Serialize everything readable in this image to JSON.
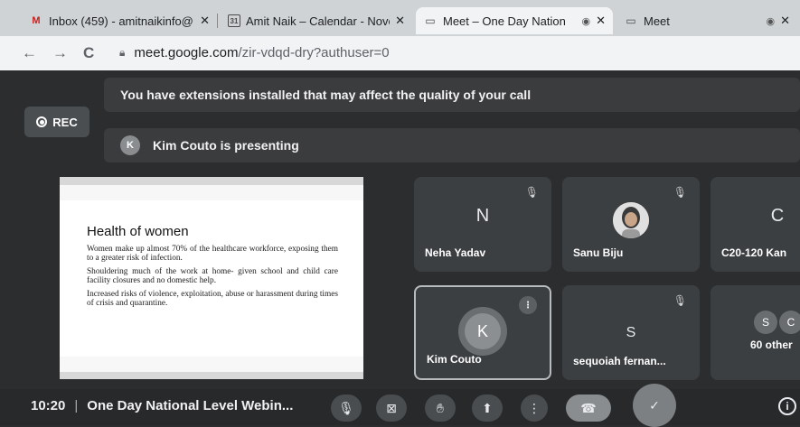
{
  "browser": {
    "tabs": [
      {
        "title": "Inbox (459) - amitnaikinfo@",
        "icon": "gmail-icon",
        "active": false
      },
      {
        "title": "Amit Naik – Calendar - Nove",
        "icon": "calendar-icon",
        "icon_text": "31",
        "active": false
      },
      {
        "title": "Meet – One Day Nation",
        "icon": "meet-icon",
        "active": true
      },
      {
        "title": "Meet",
        "icon": "meet-icon",
        "active": false
      }
    ],
    "url_host": "meet.google.com",
    "url_path": "/zir-vdqd-dry?authuser=0"
  },
  "meet": {
    "extensions_banner": "You have extensions installed that may affect the quality of your call",
    "rec_label": "REC",
    "presenter_initial": "K",
    "presenting_text": "Kim Couto is presenting",
    "slide": {
      "title": "Health of women",
      "paragraphs": [
        "Women make up almost 70% of the healthcare workforce, exposing them to a greater risk of infection.",
        "Shouldering much of the work at home- given school and child care facility closures and no domestic help.",
        "Increased risks of violence, exploitation, abuse or harassment during times of crisis and quarantine."
      ]
    },
    "participants": [
      {
        "name": "Neha Yadav",
        "initial": "N",
        "muted": true
      },
      {
        "name": "Sanu Biju",
        "initial": "",
        "muted": true
      },
      {
        "name": "C20-120 Kan",
        "initial": "C",
        "muted": false
      },
      {
        "name": "Kim Couto",
        "initial": "K",
        "muted": false,
        "speaking": true
      },
      {
        "name": "sequoiah fernan...",
        "initial": "S",
        "muted": true
      },
      {
        "name": "60 other",
        "initials": [
          "S",
          "C"
        ]
      }
    ],
    "time": "10:20",
    "separator": "|",
    "meeting_title": "One Day National Level Webin..."
  }
}
